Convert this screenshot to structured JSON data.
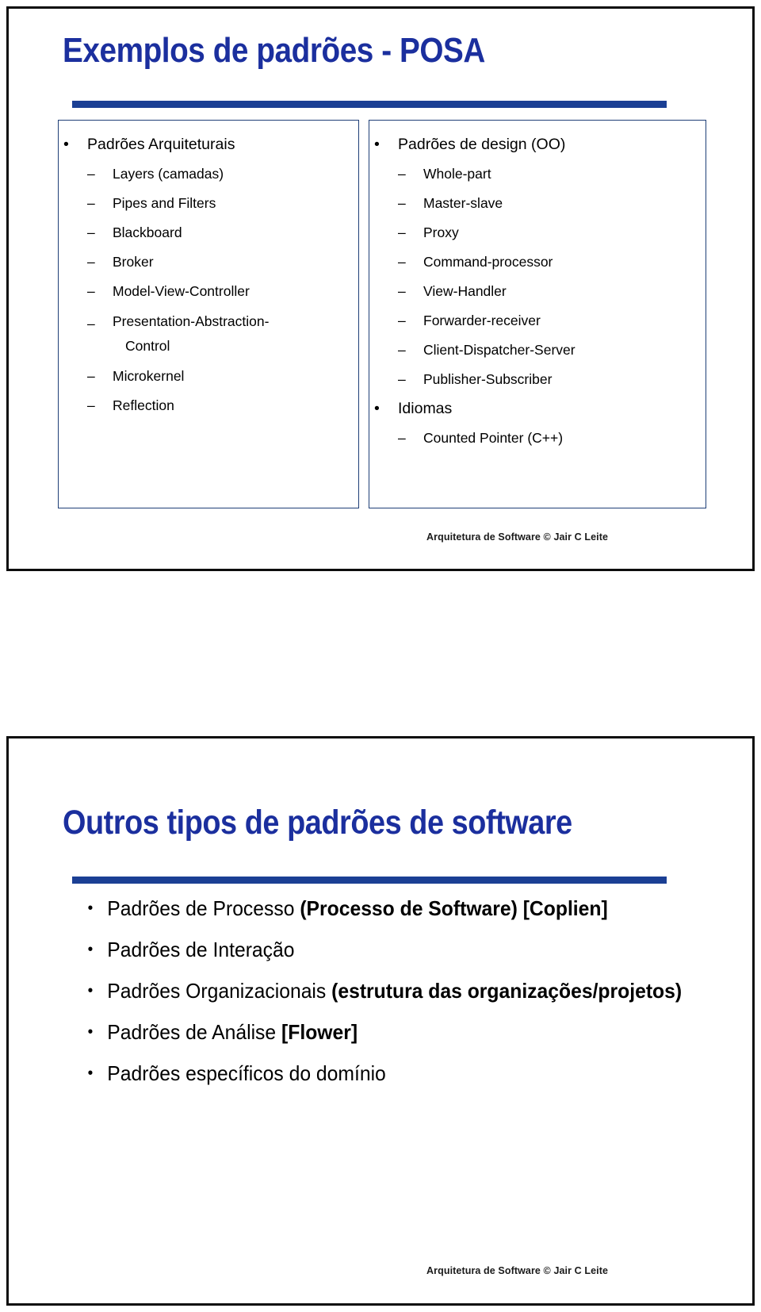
{
  "slides": [
    {
      "id": "slide-1",
      "title": "Exemplos de padrões - POSA",
      "columns": [
        {
          "name": "left-column",
          "heading": "Padrões Arquiteturais",
          "items": [
            "Layers (camadas)",
            "Pipes and Filters",
            "Blackboard",
            "Broker",
            "Model-View-Controller",
            "Presentation-Abstraction-",
            "Control",
            "Microkernel",
            "Reflection"
          ]
        },
        {
          "name": "right-column",
          "heading": "Padrões de design (OO)",
          "items": [
            "Whole-part",
            "Master-slave",
            "Proxy",
            "Command-processor",
            "View-Handler",
            "Forwarder-receiver",
            "Client-Dispatcher-Server",
            "Publisher-Subscriber"
          ],
          "heading2": "Idiomas",
          "items2": [
            "Counted Pointer (C++)"
          ]
        }
      ],
      "footer": "Arquitetura de Software  © Jair C Leite"
    },
    {
      "id": "slide-2",
      "title": "Outros tipos de padrões de software",
      "bullets": [
        {
          "plain": "Padrões de Processo ",
          "bold": "(Processo de Software) [Coplien]"
        },
        {
          "plain": "Padrões de Interação",
          "bold": ""
        },
        {
          "plain": "Padrões Organizacionais ",
          "bold": "(estrutura das organizações/projetos)"
        },
        {
          "plain": "Padrões de Análise ",
          "bold": "[Flower]"
        },
        {
          "plain": "Padrões específicos do domínio",
          "bold": ""
        }
      ],
      "footer": "Arquitetura de Software  © Jair C Leite"
    }
  ],
  "colors": {
    "title_blue": "#1b2f9e",
    "rule_blue": "#1b3f94",
    "box_border_blue": "#1f3f77",
    "page_border": "#0d0d0d",
    "text_black": "#000000"
  }
}
